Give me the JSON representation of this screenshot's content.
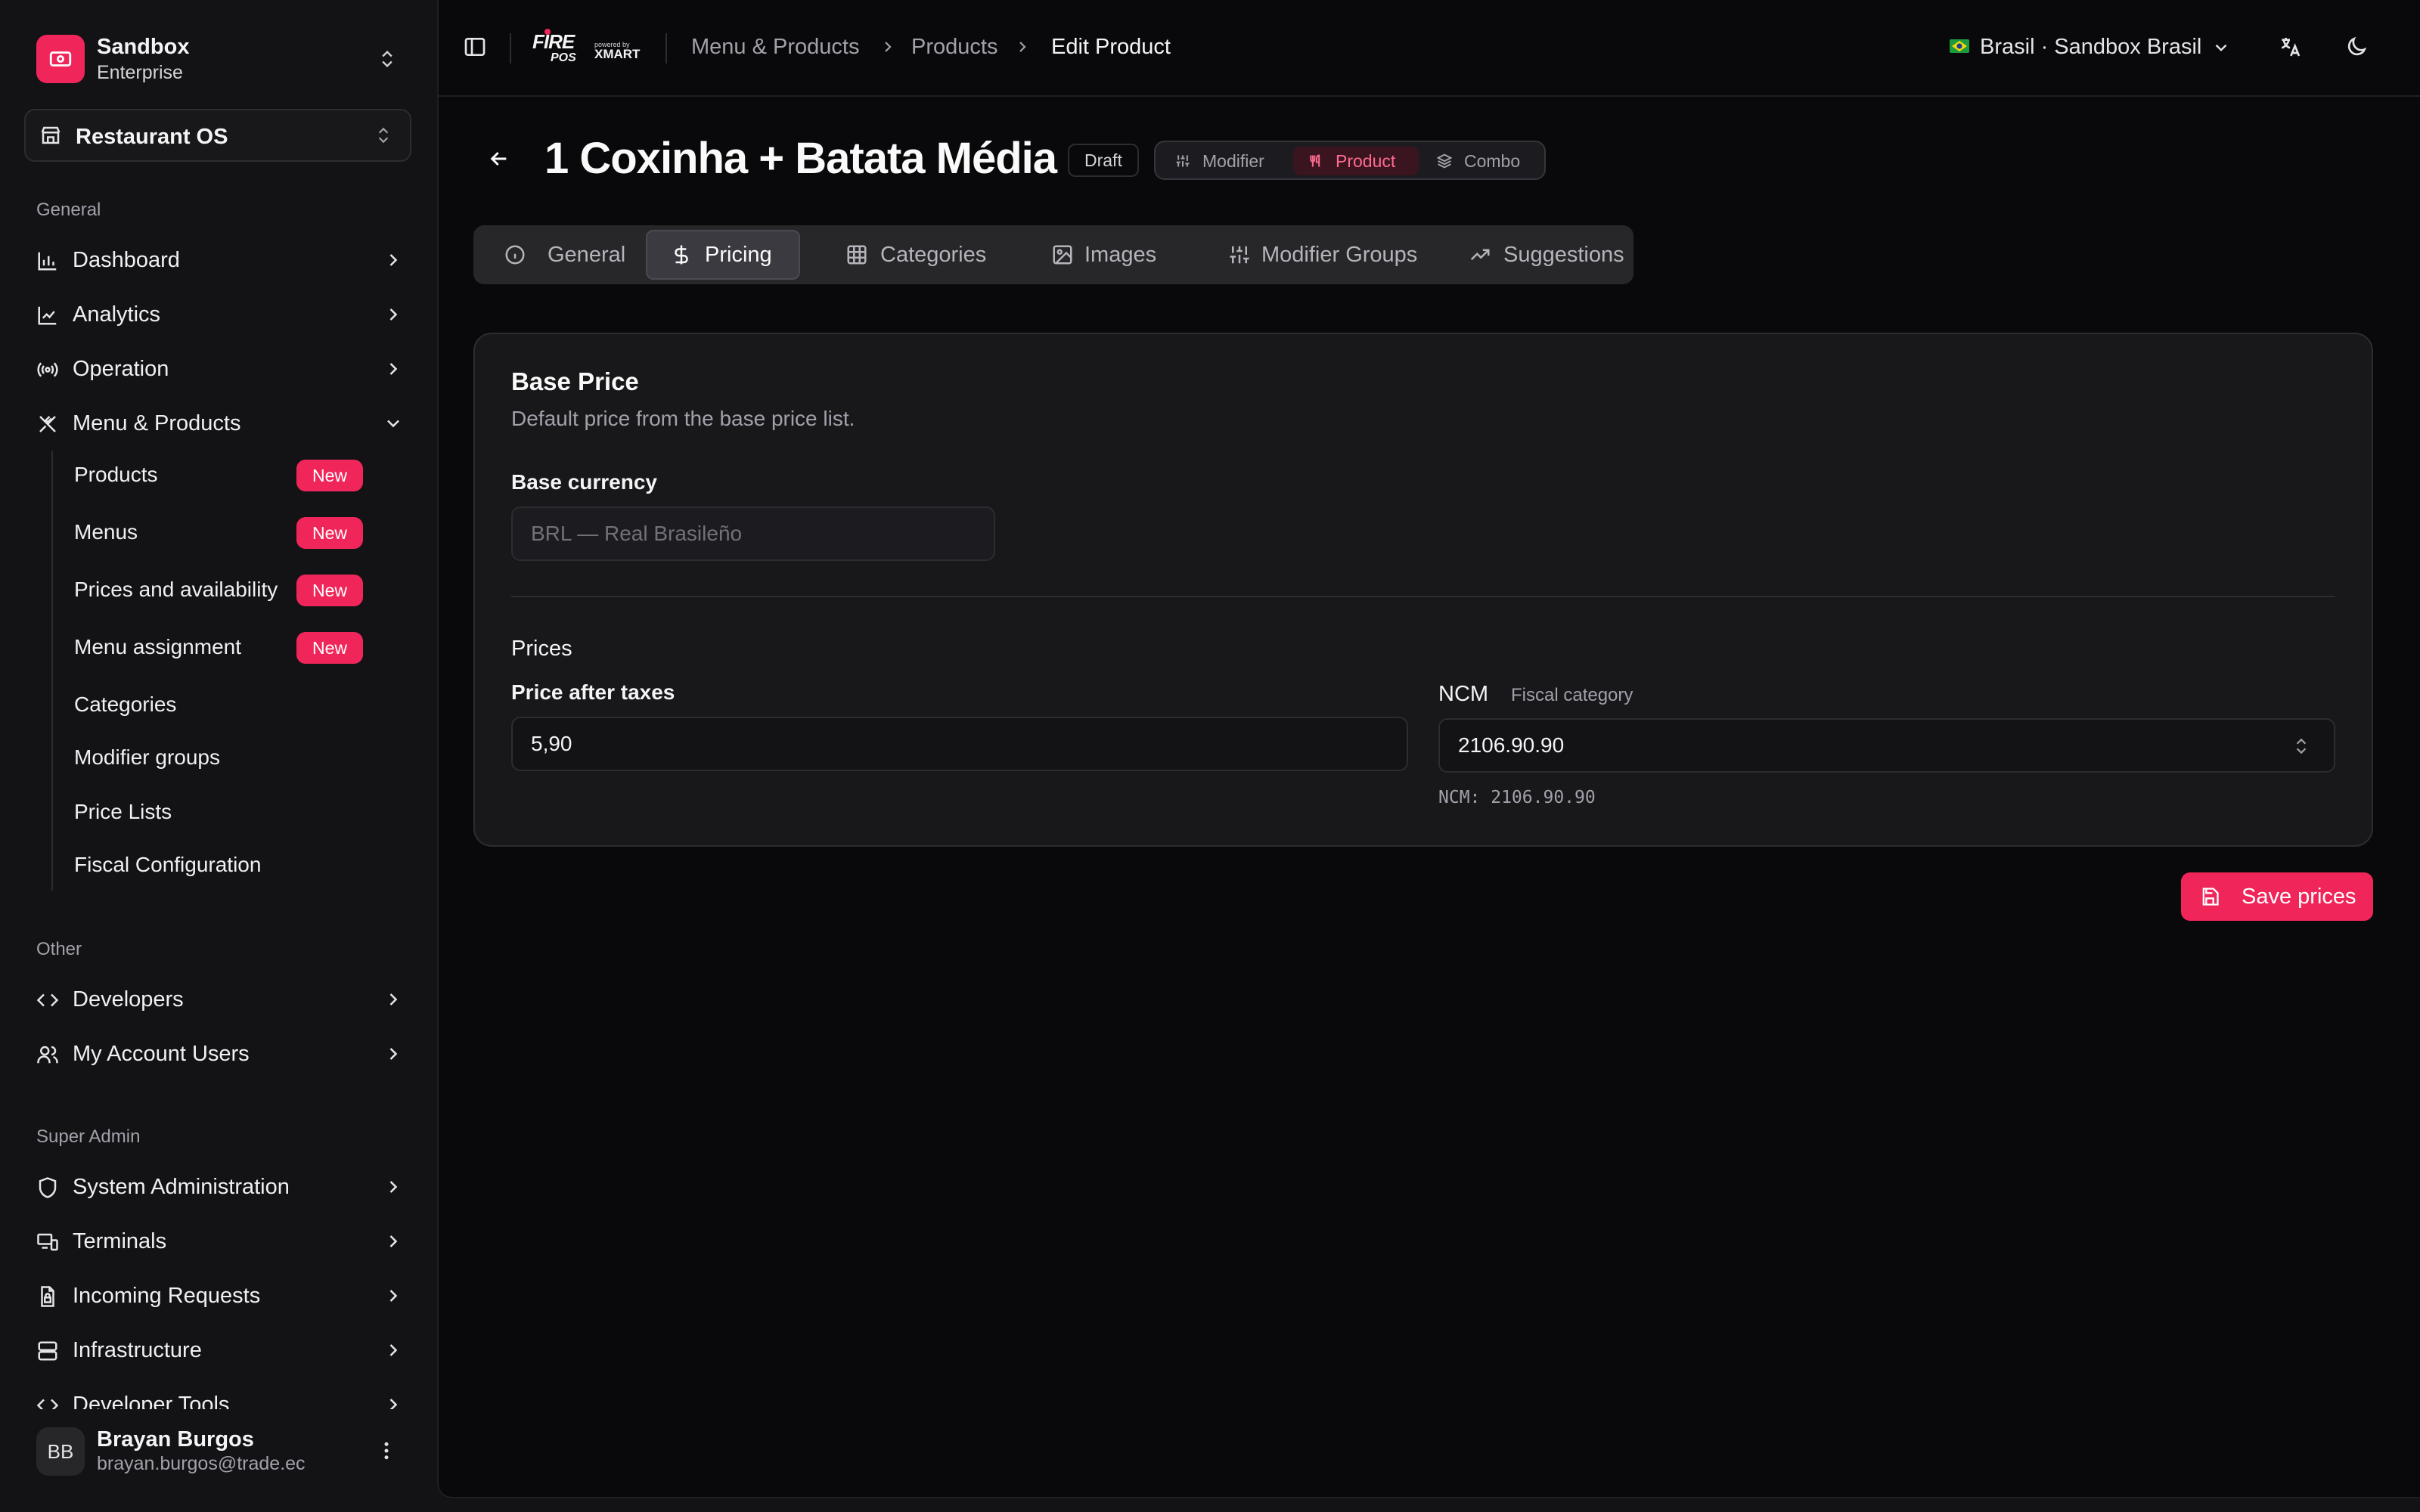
{
  "sidebar": {
    "org_name": "Sandbox",
    "org_plan": "Enterprise",
    "workspace": "Restaurant OS",
    "section_general": "General",
    "nav_general": [
      "Dashboard",
      "Analytics",
      "Operation",
      "Menu & Products"
    ],
    "submenu": [
      {
        "label": "Products",
        "badge": "New"
      },
      {
        "label": "Menus",
        "badge": "New"
      },
      {
        "label": "Prices and availability",
        "badge": "New"
      },
      {
        "label": "Menu assignment",
        "badge": "New"
      },
      {
        "label": "Categories"
      },
      {
        "label": "Modifier groups"
      },
      {
        "label": "Price Lists"
      },
      {
        "label": "Fiscal Configuration"
      }
    ],
    "section_other": "Other",
    "nav_other": [
      "Developers",
      "My Account Users"
    ],
    "section_super": "Super Admin",
    "nav_super": [
      "System Administration",
      "Terminals",
      "Incoming Requests",
      "Infrastructure",
      "Developer Tools"
    ],
    "user": {
      "initials": "BB",
      "name": "Brayan Burgos",
      "email": "brayan.burgos@trade.ec"
    }
  },
  "topbar": {
    "logo_fire": "FIRE",
    "logo_pos": "POS",
    "logo_powered": "powered by",
    "logo_xmart": "XMART",
    "breadcrumb": [
      "Menu & Products",
      "Products",
      "Edit Product"
    ],
    "region": "Brasil · Sandbox Brasil"
  },
  "product": {
    "title": "1 Coxinha + Batata Média",
    "status": "Draft",
    "types": [
      "Modifier",
      "Product",
      "Combo"
    ],
    "active_type": "Product"
  },
  "tabs": [
    "General",
    "Pricing",
    "Categories",
    "Images",
    "Modifier Groups",
    "Suggestions"
  ],
  "active_tab": "Pricing",
  "pricing": {
    "title": "Base Price",
    "description": "Default price from the base price list.",
    "currency_label": "Base currency",
    "currency_value": "BRL — Real Brasileño",
    "prices_heading": "Prices",
    "price_label": "Price after taxes",
    "price_value": "5,90",
    "ncm_label": "NCM",
    "ncm_sub": "Fiscal category",
    "ncm_value": "2106.90.90",
    "ncm_hint": "NCM: 2106.90.90",
    "save_label": "Save prices"
  },
  "colors": {
    "accent": "#f0265a",
    "background": "#09090b",
    "sidebar": "#131316"
  }
}
